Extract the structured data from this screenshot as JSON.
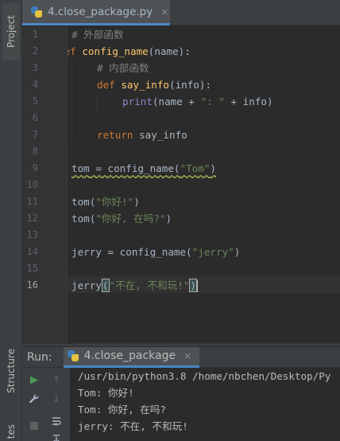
{
  "sidebar": {
    "project_label": "Project",
    "structure_label": "Structure",
    "favorites_label": "tes"
  },
  "editor": {
    "tab": {
      "filename": "4.close_package.py",
      "close": "×"
    },
    "line_numbers": [
      "1",
      "2",
      "3",
      "4",
      "5",
      "6",
      "7",
      "8",
      "9",
      "10",
      "11",
      "12",
      "13",
      "14",
      "15",
      "16"
    ],
    "code": {
      "l1_comment": "# 外部函数",
      "l2_def": "def",
      "l2_name": "config_name",
      "l2_rest": "(name):",
      "l3_comment": "# 内部函数",
      "l4_def": "def",
      "l4_name": "say_info",
      "l4_rest": "(info):",
      "l5_print": "print",
      "l5_a": "(name + ",
      "l5_str": "\": \"",
      "l5_b": " + info)",
      "l7_return": "return",
      "l7_rest": " say_info",
      "l9_var": "tom",
      "l9_mid": " = config_name(",
      "l9_str": "\"Tom\"",
      "l9_end": ")",
      "l11_a": "tom(",
      "l11_str": "\"你好!\"",
      "l11_b": ")",
      "l12_a": "tom(",
      "l12_str": "\"你好, 在吗?\"",
      "l12_b": ")",
      "l14_a": "jerry = config_name(",
      "l14_str": "\"jerry\"",
      "l14_b": ")",
      "l16_a": "jerry",
      "l16_open": "(",
      "l16_str": "\"不在, 不和玩!\"",
      "l16_close": ")"
    }
  },
  "run": {
    "label": "Run:",
    "tab_name": "4.close_package",
    "close": "×",
    "output": [
      "/usr/bin/python3.8 /home/nbchen/Desktop/Py",
      "Tom: 你好!",
      "Tom: 你好, 在吗?",
      "jerry: 不在, 不和玩!"
    ]
  },
  "colors": {
    "keyword": "#cc7832",
    "function_name": "#ffc66d",
    "comment": "#808080",
    "string": "#6a8759",
    "builtin": "#8888c6",
    "run_green": "#499c54"
  }
}
